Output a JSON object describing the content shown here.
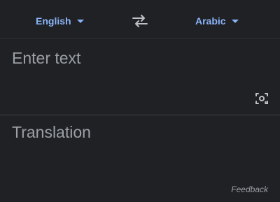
{
  "languages": {
    "source": "English",
    "target": "Arabic"
  },
  "source_panel": {
    "placeholder": "Enter text"
  },
  "target_panel": {
    "placeholder": "Translation"
  },
  "footer": {
    "feedback_label": "Feedback"
  },
  "icons": {
    "swap": "swap-languages-icon",
    "camera": "camera-lens-icon",
    "dropdown": "caret-down-icon"
  },
  "colors": {
    "background": "#202124",
    "accent": "#8ab4f8",
    "muted_text": "#9aa0a6",
    "icon": "#bdc1c6"
  }
}
